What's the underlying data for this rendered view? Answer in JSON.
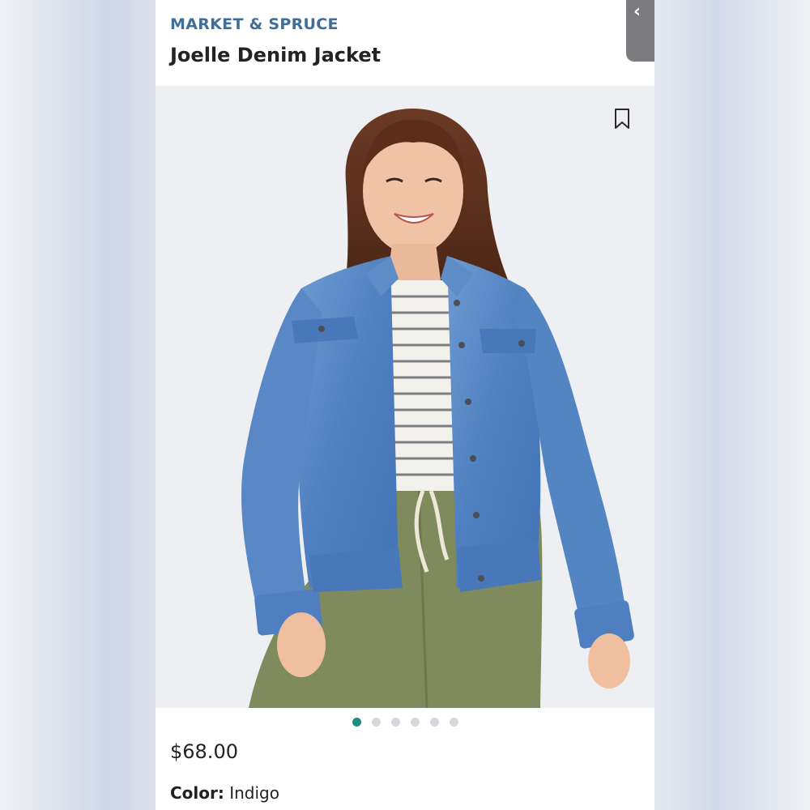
{
  "product": {
    "brand": "MARKET & SPRUCE",
    "title": "Joelle Denim Jacket",
    "price": "$68.00",
    "color_label": "Color:",
    "color_value": "Indigo"
  },
  "gallery": {
    "image_count": 6,
    "active_index": 0
  },
  "icons": {
    "bookmark": "bookmark-icon",
    "back": "chevron-left-icon"
  },
  "colors": {
    "brand": "#3f6e98",
    "active_dot": "#1e8c86",
    "inactive_dot": "#d4d7dc"
  }
}
